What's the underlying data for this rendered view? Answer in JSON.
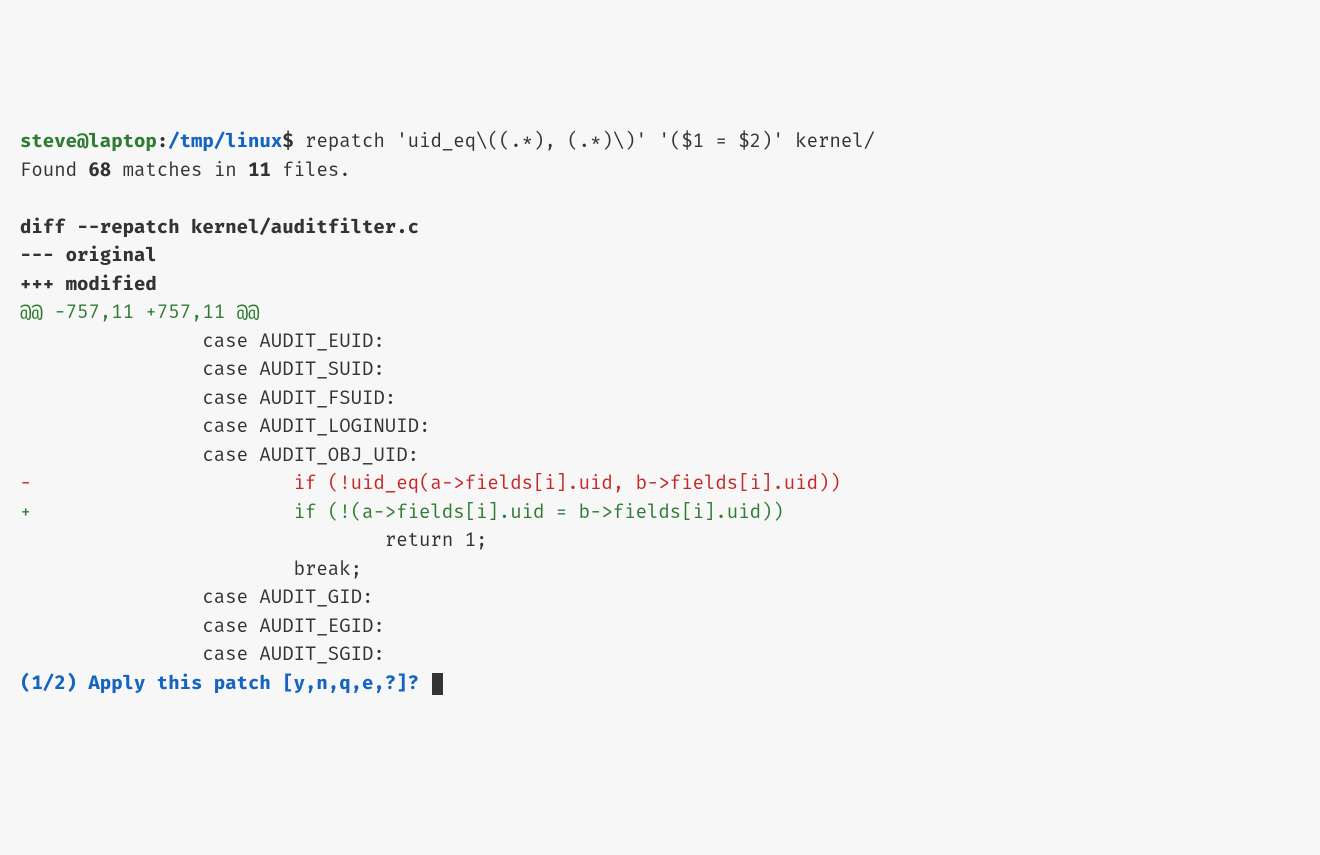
{
  "prompt": {
    "user": "steve@laptop",
    "colon": ":",
    "path": "/tmp/linux",
    "dollar": "$",
    "command": " repatch 'uid_eq\\((.*), (.*)\\)' '($1 = $2)' kernel/"
  },
  "result": {
    "prefix": "Found ",
    "count1": "68",
    "mid": " matches in ",
    "count2": "11",
    "suffix": " files."
  },
  "diff": {
    "header": "diff --repatch kernel/auditfilter.c",
    "old": "--- original",
    "new": "+++ modified",
    "hunk": "@@ -757,11 +757,11 @@",
    "ctx1": "\t\tcase AUDIT_EUID:",
    "ctx2": "\t\tcase AUDIT_SUID:",
    "ctx3": "\t\tcase AUDIT_FSUID:",
    "ctx4": "\t\tcase AUDIT_LOGINUID:",
    "ctx5": "\t\tcase AUDIT_OBJ_UID:",
    "del": "-\t\t\tif (!uid_eq(a->fields[i].uid, b->fields[i].uid))",
    "add": "+\t\t\tif (!(a->fields[i].uid = b->fields[i].uid))",
    "ctx6": "\t\t\t\treturn 1;",
    "ctx7": "\t\t\tbreak;",
    "ctx8": "\t\tcase AUDIT_GID:",
    "ctx9": "\t\tcase AUDIT_EGID:",
    "ctx10": "\t\tcase AUDIT_SGID:"
  },
  "footer": {
    "text": "(1/2) Apply this patch [y,n,q,e,?]? "
  }
}
